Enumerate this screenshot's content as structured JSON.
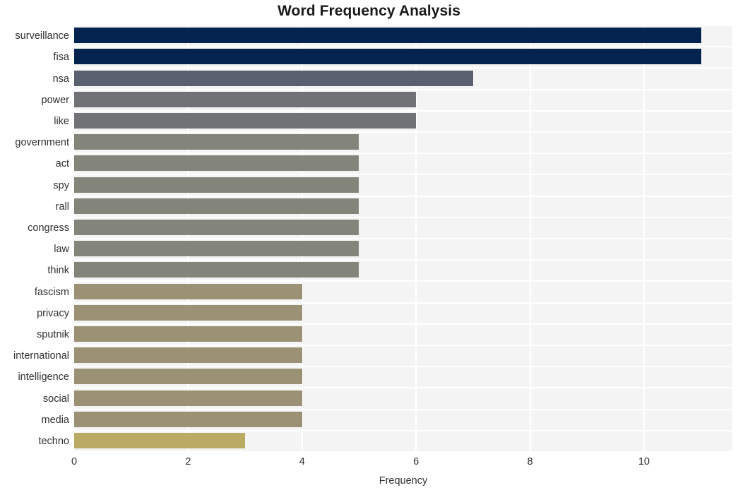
{
  "chart_data": {
    "type": "bar",
    "orientation": "horizontal",
    "title": "Word Frequency Analysis",
    "xlabel": "Frequency",
    "ylabel": "",
    "categories": [
      "surveillance",
      "fisa",
      "nsa",
      "power",
      "like",
      "government",
      "act",
      "spy",
      "rall",
      "congress",
      "law",
      "think",
      "fascism",
      "privacy",
      "sputnik",
      "international",
      "intelligence",
      "social",
      "media",
      "techno"
    ],
    "values": [
      11,
      11,
      7,
      6,
      6,
      5,
      5,
      5,
      5,
      5,
      5,
      5,
      4,
      4,
      4,
      4,
      4,
      4,
      4,
      3
    ],
    "bar_colors": [
      "#04234f",
      "#04234f",
      "#5b6070",
      "#707276",
      "#707276",
      "#84857a",
      "#84857a",
      "#84857a",
      "#84857a",
      "#84857a",
      "#84857a",
      "#84857a",
      "#9b9275",
      "#9b9275",
      "#9b9275",
      "#9b9275",
      "#9b9275",
      "#9b9275",
      "#9b9275",
      "#b9ab63"
    ],
    "xlim": [
      0,
      11.55
    ],
    "ylim": [
      0,
      20
    ],
    "xticks": [
      0,
      2,
      4,
      6,
      8,
      10
    ],
    "xtick_labels": [
      "0",
      "2",
      "4",
      "6",
      "8",
      "10"
    ],
    "grid": true,
    "grid_color": "#ffffff",
    "plot_background": "#f4f4f4",
    "figure_background": "#ffffff",
    "legend": null
  }
}
